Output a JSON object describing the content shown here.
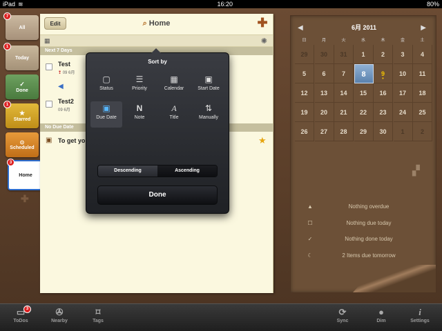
{
  "status": {
    "carrier": "iPad",
    "time": "16:20",
    "battery": "80%"
  },
  "sidebar": {
    "tabs": [
      {
        "label": "All",
        "badge": "7"
      },
      {
        "label": "Today",
        "badge": "1"
      },
      {
        "label": "Done",
        "badge": ""
      },
      {
        "label": "Starred",
        "badge": "1"
      },
      {
        "label": "Scheduled",
        "badge": ""
      },
      {
        "label": "Home",
        "badge": "3"
      }
    ]
  },
  "note": {
    "edit_label": "Edit",
    "title": "Home",
    "section_next7": "Next 7 Days",
    "section_nodue": "No Due Date",
    "tasks": [
      {
        "title": "Test",
        "date": "09 6月"
      },
      {
        "title": "Test2",
        "date": "09 6月"
      },
      {
        "title": "To get yo"
      }
    ]
  },
  "popover": {
    "title": "Sort by",
    "options": [
      {
        "label": "Status",
        "icon": "square-icon"
      },
      {
        "label": "Priority",
        "icon": "lines-icon"
      },
      {
        "label": "Calendar",
        "icon": "calendar-icon"
      },
      {
        "label": "Start Date",
        "icon": "start-date-icon"
      },
      {
        "label": "Due Date",
        "icon": "due-date-icon"
      },
      {
        "label": "Note",
        "icon": "note-icon"
      },
      {
        "label": "Title",
        "icon": "title-icon"
      },
      {
        "label": "Manually",
        "icon": "arrows-icon"
      }
    ],
    "descending": "Descending",
    "ascending": "Ascending",
    "done": "Done"
  },
  "calendar": {
    "month": "6月 2011",
    "weekdays": [
      "日",
      "月",
      "火",
      "水",
      "木",
      "金",
      "土"
    ],
    "rows": [
      [
        "29",
        "30",
        "31",
        "1",
        "2",
        "3",
        "4"
      ],
      [
        "5",
        "6",
        "7",
        "8",
        "9",
        "10",
        "11"
      ],
      [
        "12",
        "13",
        "14",
        "15",
        "16",
        "17",
        "18"
      ],
      [
        "19",
        "20",
        "21",
        "22",
        "23",
        "24",
        "25"
      ],
      [
        "26",
        "27",
        "28",
        "29",
        "30",
        "1",
        "2"
      ]
    ],
    "summary": [
      "Nothing overdue",
      "Nothing due today",
      "Nothing done today",
      "2 Items due tomorrow"
    ]
  },
  "tabbar": {
    "items": [
      {
        "label": "ToDos",
        "badge": "3"
      },
      {
        "label": "Nearby"
      },
      {
        "label": "Tags"
      },
      {
        "label": "Sync"
      },
      {
        "label": "Dim"
      },
      {
        "label": "Settings"
      }
    ]
  }
}
